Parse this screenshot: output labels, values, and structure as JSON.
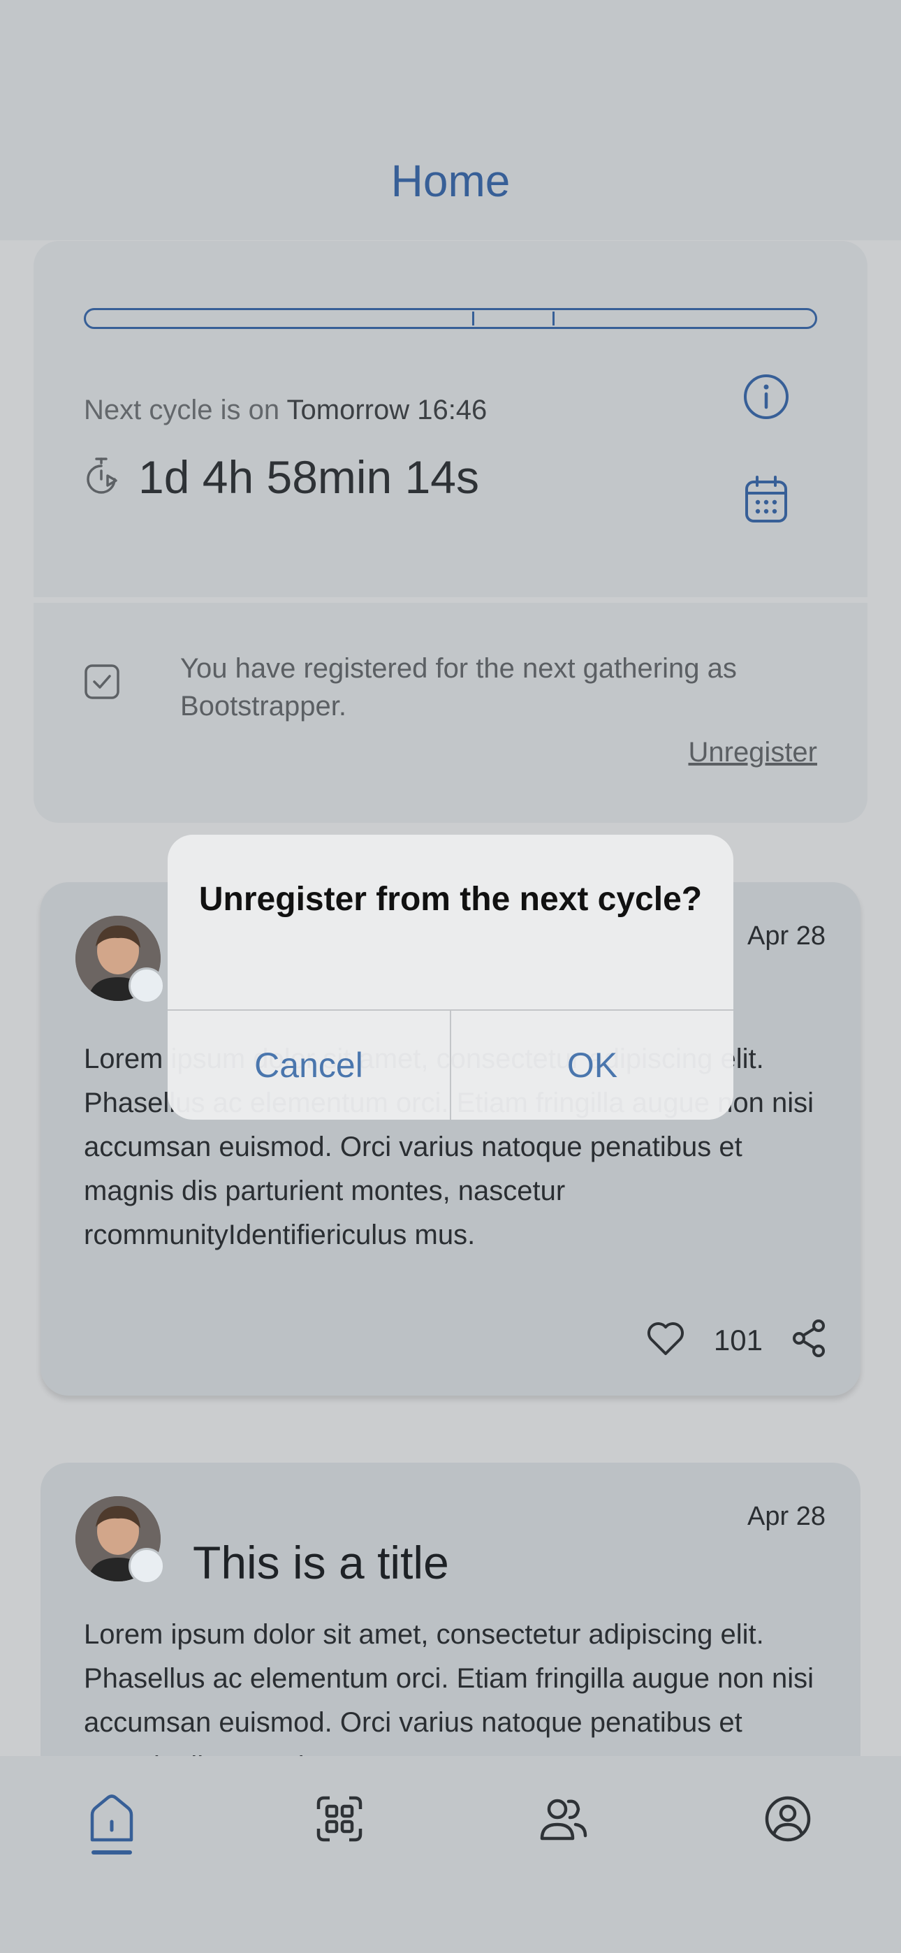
{
  "header": {
    "title": "Home"
  },
  "cycle": {
    "progress_markers": [
      0.53,
      0.64
    ],
    "next_cycle_prefix": "Next cycle is on",
    "next_cycle_date": "Tomorrow 16:46",
    "countdown": "1d 4h 58min 14s",
    "registration_text": "You have registered for the next gathering as Bootstrapper.",
    "unregister_label": "Unregister"
  },
  "posts": [
    {
      "date": "Apr 28",
      "title": "",
      "body": "Lorem ipsum dolor sit amet, consectetur adipiscing elit. Phasellus ac elementum orci. Etiam fringilla augue non nisi accumsan euismod. Orci varius natoque penatibus et magnis dis parturient montes, nascetur rcommunityIdentifiericulus mus.",
      "likes": "101"
    },
    {
      "date": "Apr 28",
      "title": "This is a title",
      "body": "Lorem ipsum dolor sit amet, consectetur adipiscing elit. Phasellus ac elementum orci. Etiam fringilla augue non nisi accumsan euismod. Orci varius natoque penatibus et magnis dis parturient"
    }
  ],
  "dialog": {
    "title": "Unregister from the next cycle?",
    "cancel_label": "Cancel",
    "ok_label": "OK"
  },
  "nav": {
    "items": [
      "home-icon",
      "scan-icon",
      "community-icon",
      "profile-icon"
    ],
    "active": "home-icon"
  },
  "colors": {
    "accent": "#375f97",
    "dialog_button": "#4a76ad"
  }
}
